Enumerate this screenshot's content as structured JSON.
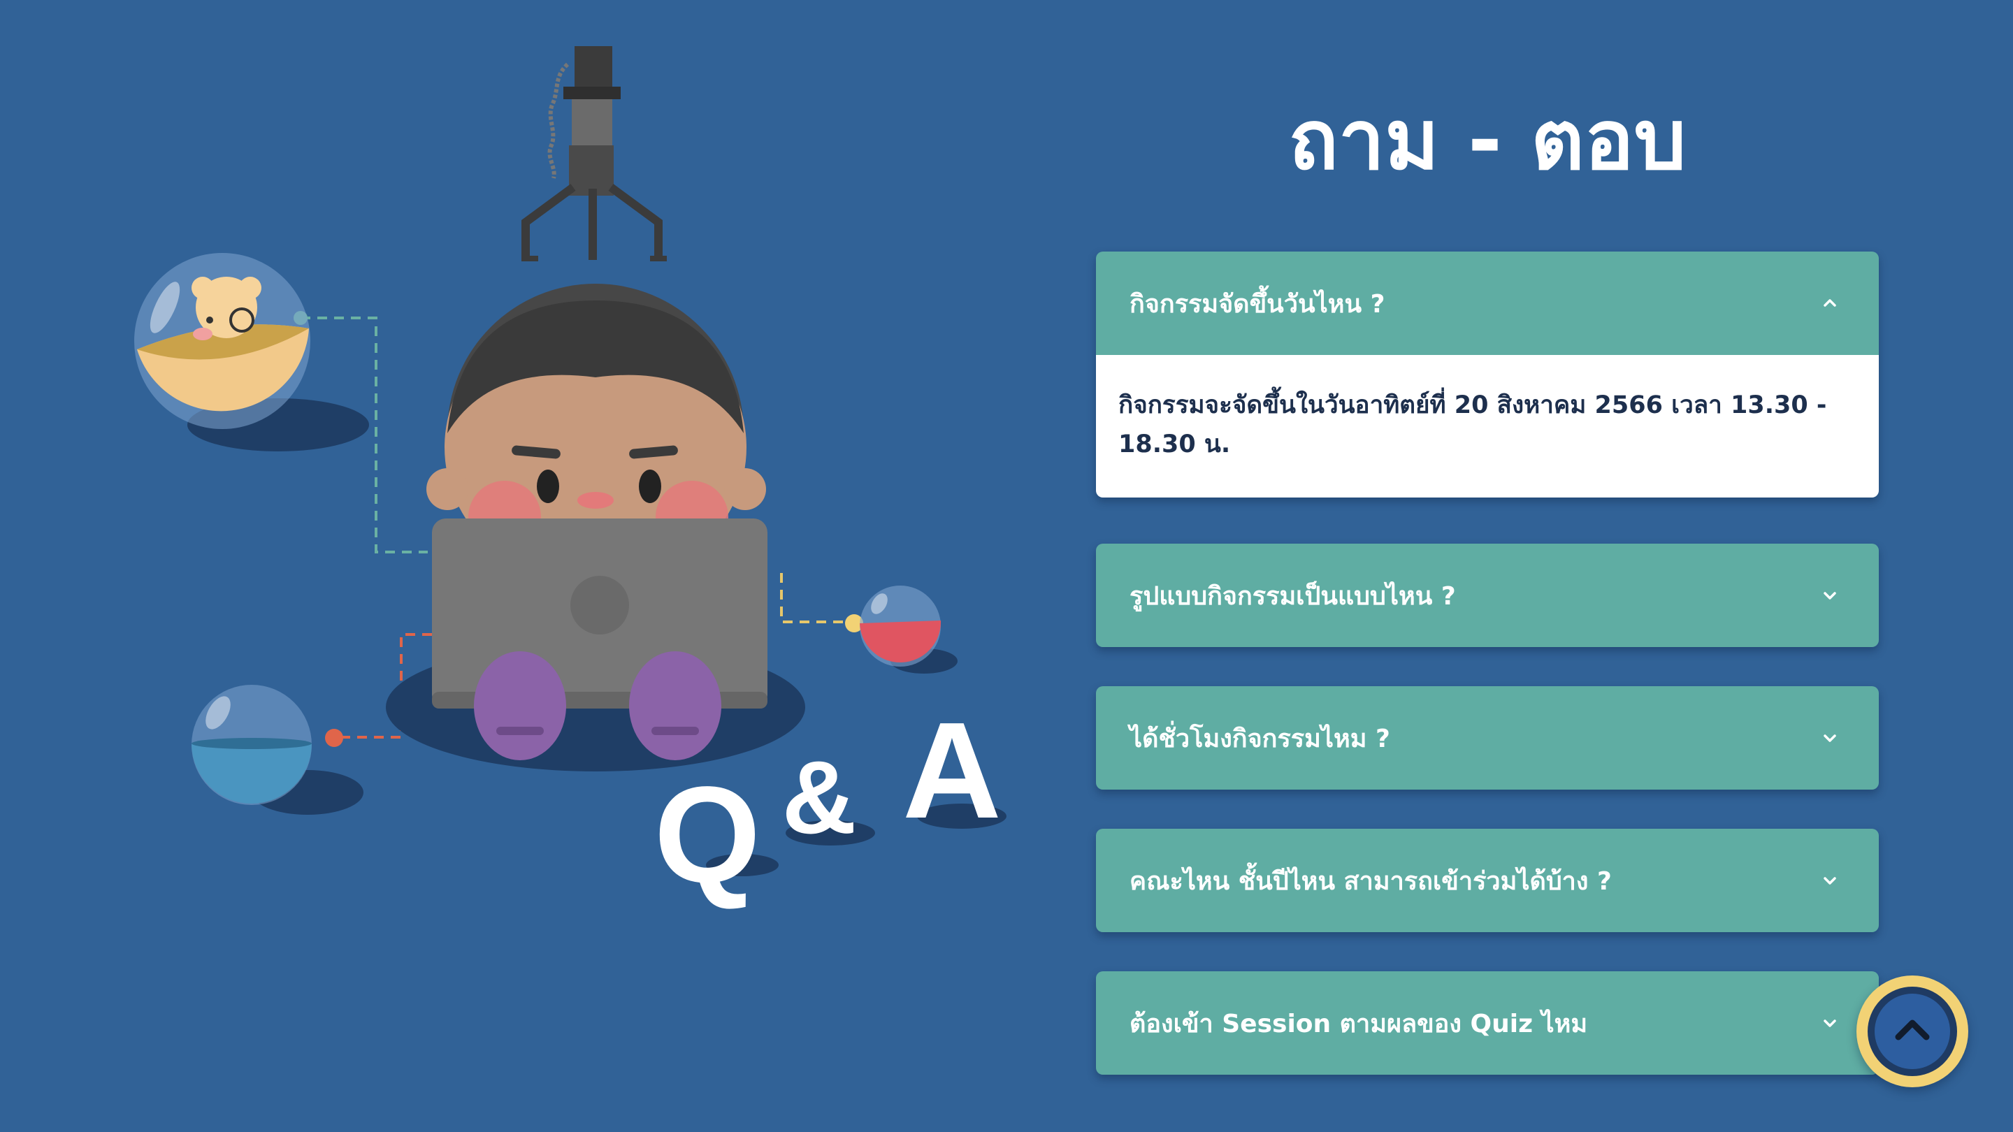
{
  "colors": {
    "background": "#316297",
    "accordion_header": "#5fada3",
    "accordion_body": "#ffffff",
    "answer_text": "#1d2f4d",
    "scroll_button": "#f2d275"
  },
  "illustration": {
    "q_letter": "Q",
    "ampersand": "&",
    "a_letter": "A"
  },
  "page": {
    "title": "ถาม - ตอบ"
  },
  "faq": {
    "items": [
      {
        "question": "กิจกรรมจัดขึ้นวันไหน ?",
        "expanded": true,
        "answer": "กิจกรรมจะจัดขึ้นในวันอาทิตย์ที่ 20 สิงหาคม 2566 เวลา 13.30 - 18.30 น.",
        "icon": "chevron-up-icon"
      },
      {
        "question": "รูปแบบกิจกรรมเป็นแบบไหน ?",
        "expanded": false,
        "icon": "chevron-down-icon"
      },
      {
        "question": "ได้ชั่วโมงกิจกรรมไหม ?",
        "expanded": false,
        "icon": "chevron-down-icon"
      },
      {
        "question": "คณะไหน ชั้นปีไหน สามารถเข้าร่วมได้บ้าง ?",
        "expanded": false,
        "icon": "chevron-down-icon"
      },
      {
        "question": "ต้องเข้า Session ตามผลของ Quiz ไหม",
        "expanded": false,
        "icon": "chevron-down-icon"
      }
    ]
  },
  "scroll_top": {
    "icon": "chevron-up-icon"
  }
}
